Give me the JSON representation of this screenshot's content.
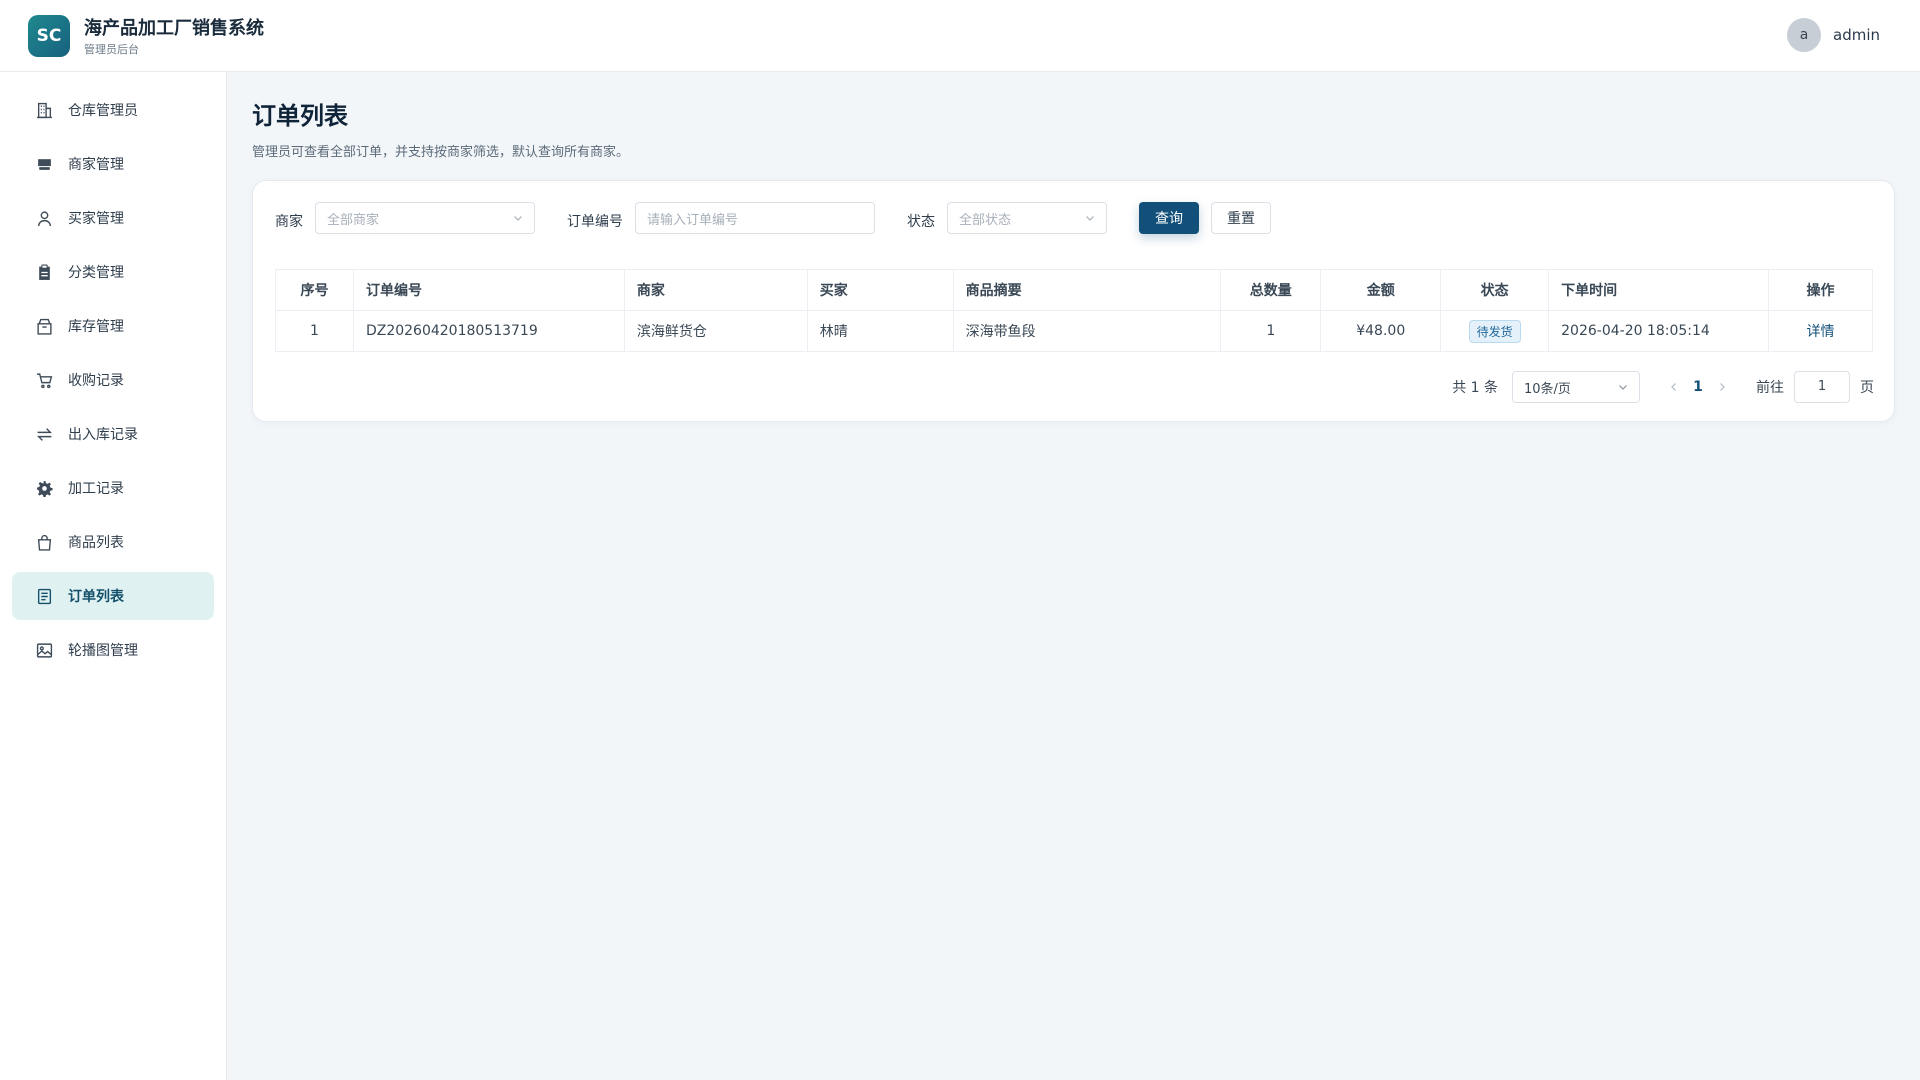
{
  "header": {
    "logo_text": "SC",
    "app_title": "海产品加工厂销售系统",
    "app_subtitle": "管理员后台",
    "avatar_letter": "a",
    "username": "admin"
  },
  "sidebar": {
    "items": [
      {
        "label": "仓库管理员",
        "icon": "building-icon"
      },
      {
        "label": "商家管理",
        "icon": "store-icon"
      },
      {
        "label": "买家管理",
        "icon": "user-icon"
      },
      {
        "label": "分类管理",
        "icon": "clipboard-icon"
      },
      {
        "label": "库存管理",
        "icon": "box-icon"
      },
      {
        "label": "收购记录",
        "icon": "cart-icon"
      },
      {
        "label": "出入库记录",
        "icon": "transfer-icon"
      },
      {
        "label": "加工记录",
        "icon": "gear-icon"
      },
      {
        "label": "商品列表",
        "icon": "bag-icon"
      },
      {
        "label": "订单列表",
        "icon": "document-icon",
        "active": true
      },
      {
        "label": "轮播图管理",
        "icon": "image-icon"
      }
    ]
  },
  "main": {
    "title": "订单列表",
    "description": "管理员可查看全部订单，并支持按商家筛选，默认查询所有商家。",
    "filters": {
      "merchant_label": "商家",
      "merchant_placeholder": "全部商家",
      "order_no_label": "订单编号",
      "order_no_placeholder": "请输入订单编号",
      "status_label": "状态",
      "status_placeholder": "全部状态",
      "query_button": "查询",
      "reset_button": "重置"
    },
    "table": {
      "columns": [
        "序号",
        "订单编号",
        "商家",
        "买家",
        "商品摘要",
        "总数量",
        "金额",
        "状态",
        "下单时间",
        "操作"
      ],
      "rows": [
        {
          "index": "1",
          "order_no": "DZ20260420180513719",
          "merchant": "滨海鲜货仓",
          "buyer": "林晴",
          "summary": "深海带鱼段",
          "quantity": "1",
          "amount": "¥48.00",
          "status": "待发货",
          "time": "2026-04-20 18:05:14",
          "action": "详情"
        }
      ]
    },
    "pagination": {
      "total_text": "共 1 条",
      "page_size": "10条/页",
      "current_page": "1",
      "goto_label": "前往",
      "goto_value": "1",
      "page_suffix": "页"
    }
  }
}
